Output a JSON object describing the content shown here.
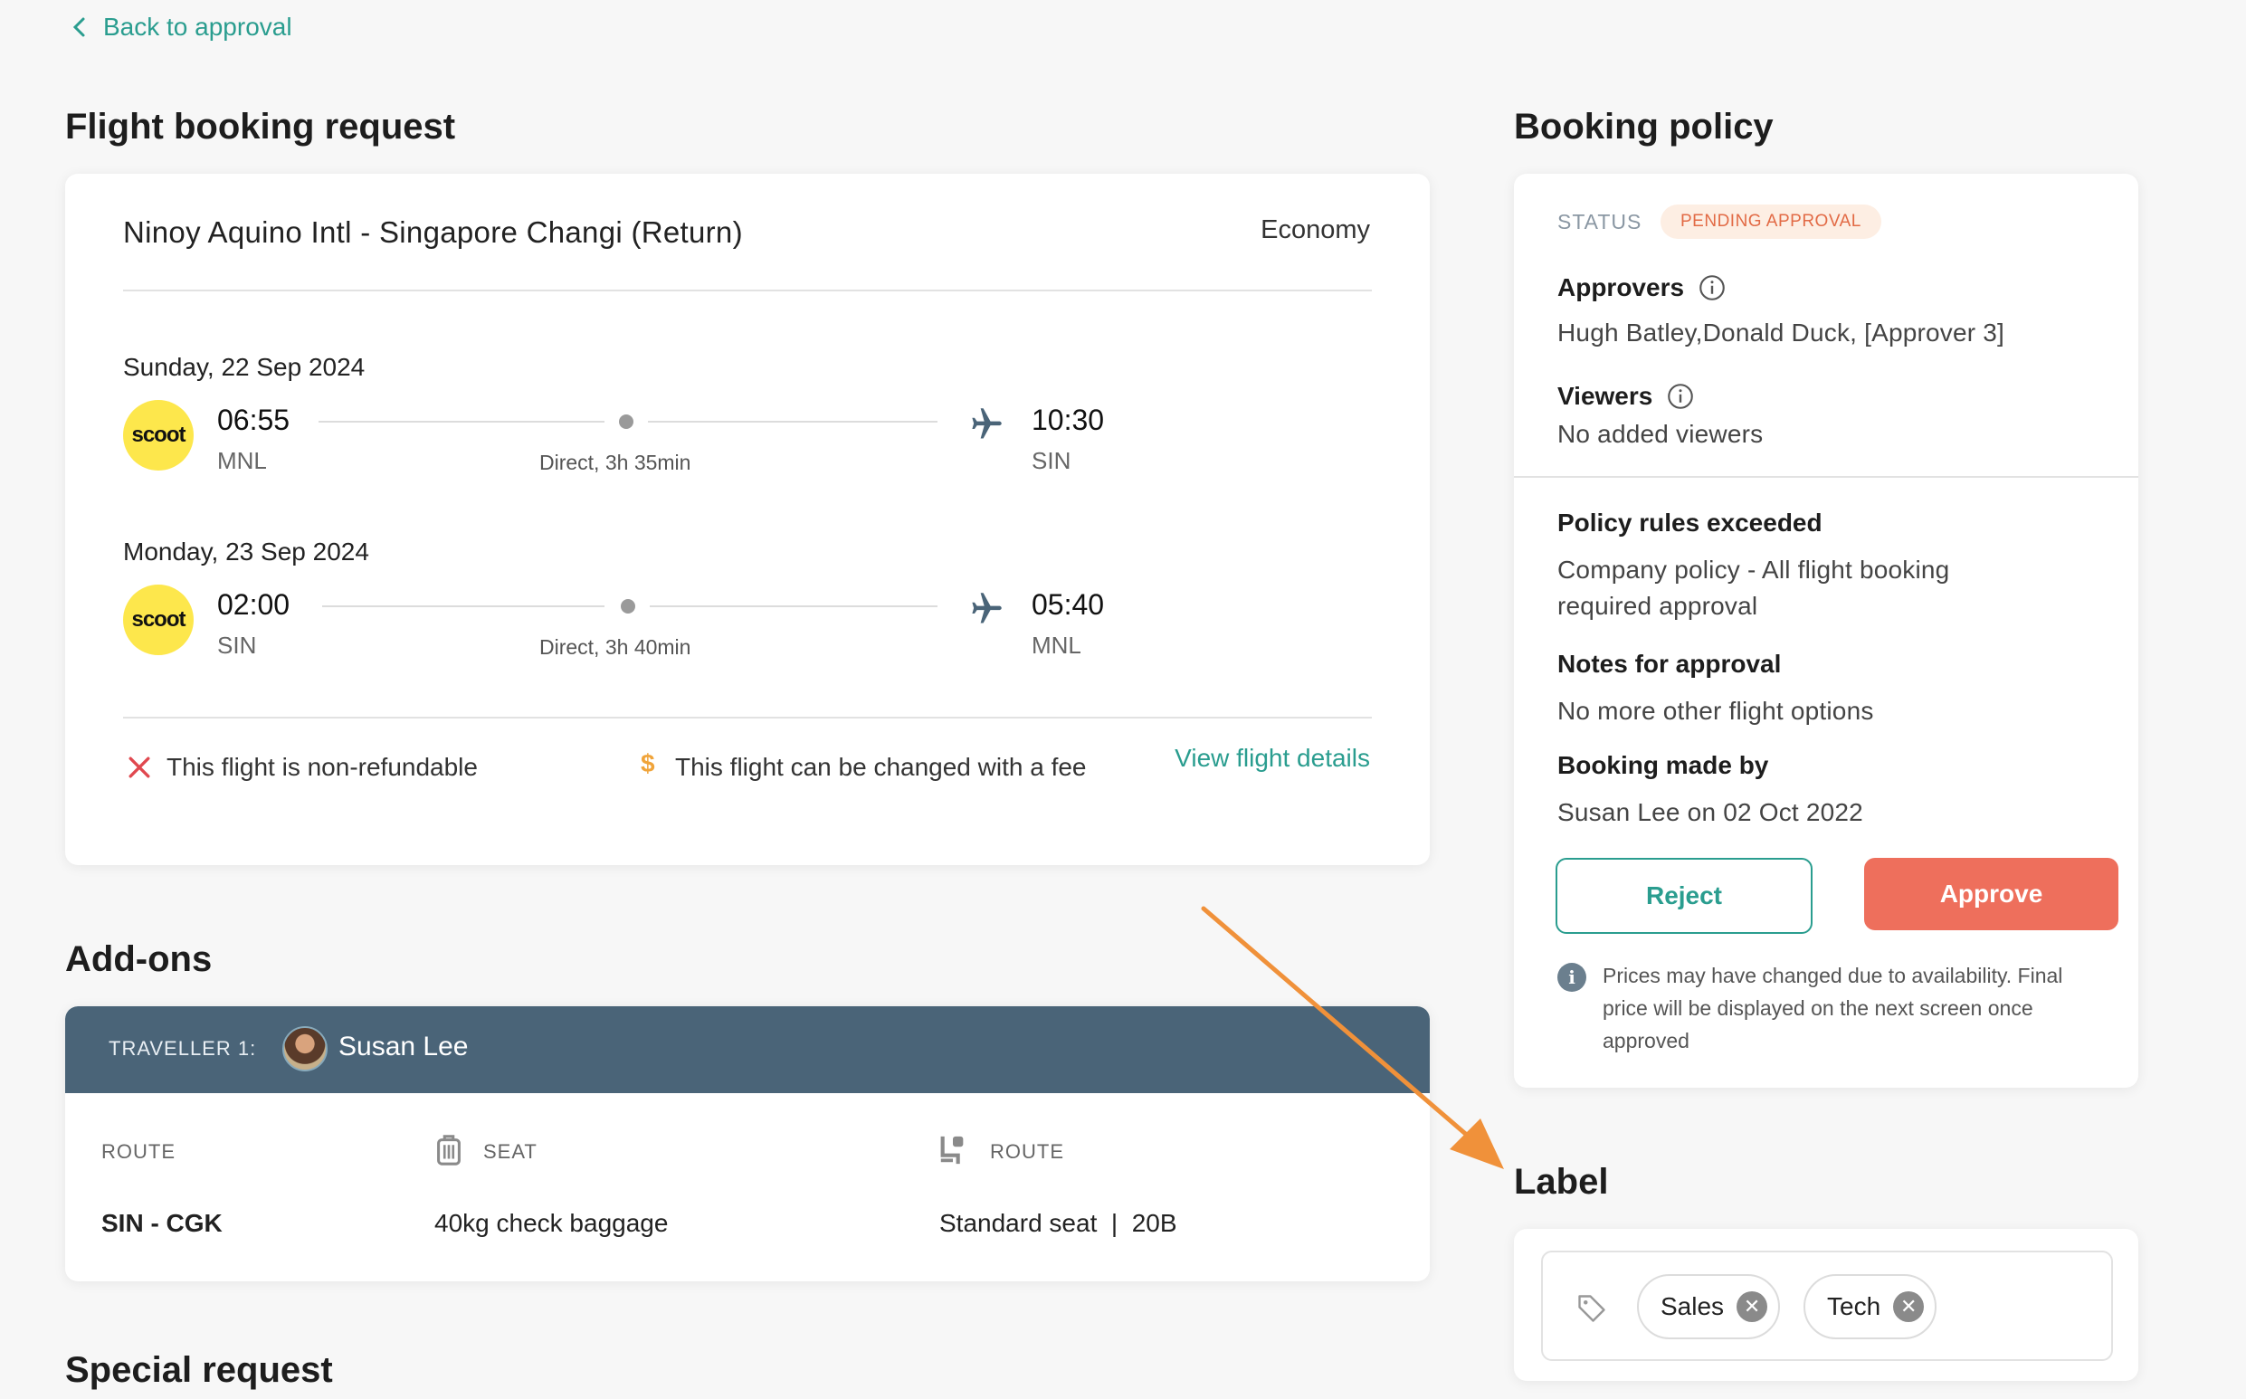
{
  "nav": {
    "back_label": "Back to approval"
  },
  "flight": {
    "section_title": "Flight booking request",
    "route": "Ninoy Aquino Intl - Singapore Changi (Return)",
    "cabin": "Economy",
    "legs": [
      {
        "date": "Sunday, 22 Sep 2024",
        "airline": "scoot",
        "dep_time": "06:55",
        "dep_code": "MNL",
        "duration": "Direct, 3h 35min",
        "arr_time": "10:30",
        "arr_code": "SIN"
      },
      {
        "date": "Monday, 23 Sep 2024",
        "airline": "scoot",
        "dep_time": "02:00",
        "dep_code": "SIN",
        "duration": "Direct, 3h 40min",
        "arr_time": "05:40",
        "arr_code": "MNL"
      }
    ],
    "refund_note": "This flight is non-refundable",
    "change_note": "This flight can be changed with a fee",
    "view_details": "View flight details",
    "colors": {
      "accent": "#2a9d8f",
      "airline_logo_bg": "#fde74c",
      "non_refund_icon": "#e0484f",
      "fee_icon": "#f0a43a"
    }
  },
  "addons": {
    "section_title": "Add-ons",
    "traveller_label": "TRAVELLER 1:",
    "traveller_name": "Susan Lee",
    "columns": [
      {
        "label": "ROUTE",
        "value": "SIN - CGK",
        "icon": null
      },
      {
        "label": "SEAT",
        "value": "40kg check baggage",
        "icon": "luggage-icon"
      },
      {
        "label": "ROUTE",
        "value": "Standard seat  |  20B",
        "icon": "seat-icon"
      }
    ],
    "header_color": "#4a6478"
  },
  "special_request": {
    "section_title": "Special request"
  },
  "policy": {
    "section_title": "Booking policy",
    "status_label": "STATUS",
    "status_value": "PENDING APPROVAL",
    "approvers_label": "Approvers",
    "approvers_value": "Hugh Batley,Donald Duck, [Approver 3]",
    "viewers_label": "Viewers",
    "viewers_value": "No added viewers",
    "rules_label": "Policy rules exceeded",
    "rules_value": "Company policy - All flight booking required approval",
    "notes_label": "Notes for approval",
    "notes_value": "No more other flight options",
    "booked_by_label": "Booking made by",
    "booked_by_value": "Susan Lee on 02 Oct 2022",
    "reject_label": "Reject",
    "approve_label": "Approve",
    "disclaimer": "Prices may have changed due to availability. Final price will be displayed on the next screen once approved",
    "colors": {
      "approve": "#ee6f5c",
      "badge_bg": "#fdeee3",
      "badge_text": "#e26a45"
    }
  },
  "label": {
    "section_title": "Label",
    "tags": [
      "Sales",
      "Tech"
    ]
  },
  "annotation": {
    "arrow_color": "#f0913a"
  }
}
